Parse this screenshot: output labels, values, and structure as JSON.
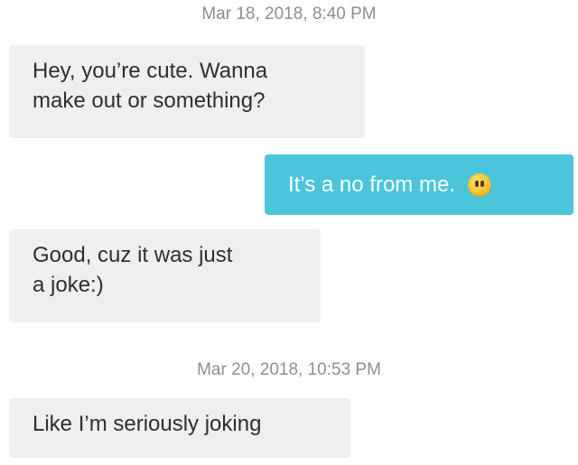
{
  "conversation": {
    "timestamps": [
      "Mar 18, 2018, 8:40 PM",
      "Mar 20, 2018, 10:53 PM"
    ],
    "messages": [
      {
        "from": "other",
        "lines": [
          "Hey, you’re cute. Wanna",
          "make out or something?"
        ]
      },
      {
        "from": "me",
        "text": "It’s a no from me.",
        "emoji": "face-without-mouth-emoji"
      },
      {
        "from": "other",
        "lines": [
          "Good, cuz it was just",
          "a joke:)"
        ]
      },
      {
        "from": "other",
        "lines": [
          "Like I’m seriously joking"
        ]
      }
    ]
  },
  "colors": {
    "incoming_bubble": "#efefef",
    "outgoing_bubble": "#4cc5da",
    "timestamp_text": "#8e8e8e"
  }
}
